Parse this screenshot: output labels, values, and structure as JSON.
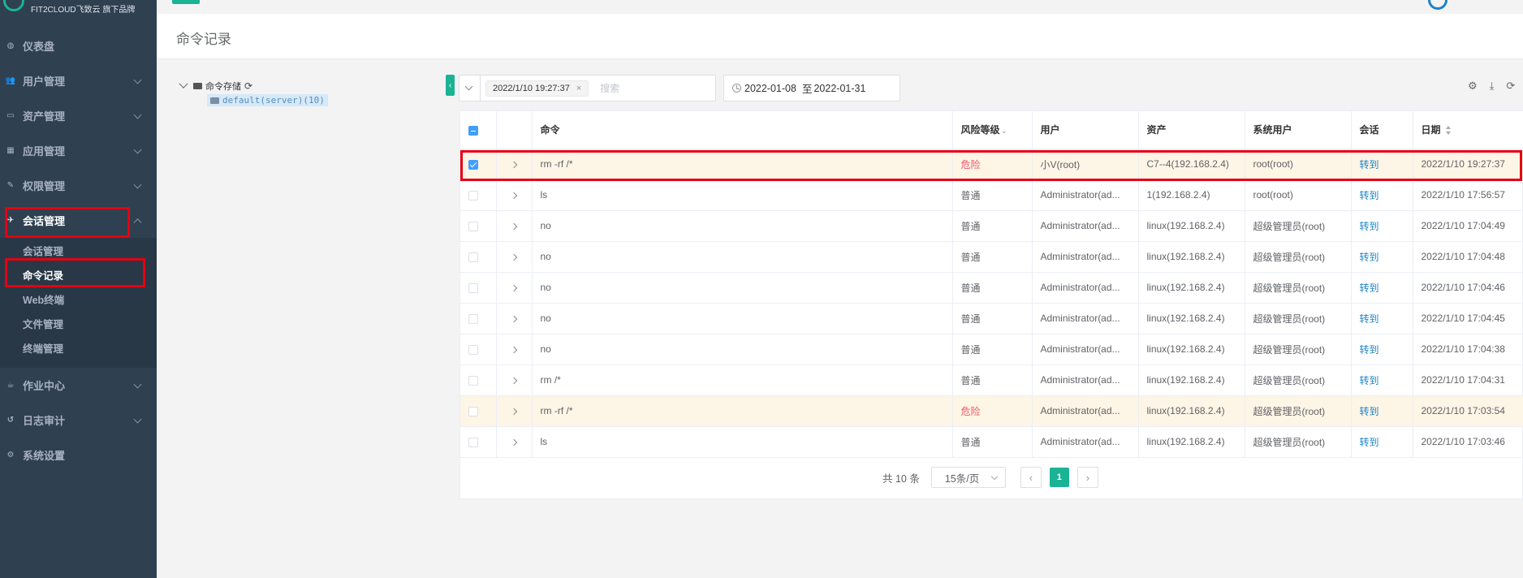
{
  "brand": {
    "text": "FIT2CLOUD飞致云 旗下品牌"
  },
  "sidebar": {
    "items": [
      {
        "label": "仪表盘",
        "icon": "dashboard-icon",
        "has_children": false
      },
      {
        "label": "用户管理",
        "icon": "users-icon",
        "has_children": true
      },
      {
        "label": "资产管理",
        "icon": "inbox-icon",
        "has_children": true
      },
      {
        "label": "应用管理",
        "icon": "grid-icon",
        "has_children": true
      },
      {
        "label": "权限管理",
        "icon": "edit-icon",
        "has_children": true
      },
      {
        "label": "会话管理",
        "icon": "rocket-icon",
        "has_children": true,
        "expanded": true
      }
    ],
    "submenu": [
      {
        "label": "会话管理"
      },
      {
        "label": "命令记录",
        "current": true
      },
      {
        "label": "Web终端"
      },
      {
        "label": "文件管理"
      },
      {
        "label": "终端管理"
      }
    ],
    "items_after": [
      {
        "label": "作业中心",
        "icon": "coffee-icon",
        "has_children": true
      },
      {
        "label": "日志审计",
        "icon": "history-icon",
        "has_children": true
      },
      {
        "label": "系统设置",
        "icon": "gears-icon",
        "has_children": false
      }
    ]
  },
  "page": {
    "title": "命令记录"
  },
  "tree": {
    "root_label": "命令存储",
    "child_label": "default(server)(10)"
  },
  "search": {
    "tag": "2022/1/10 19:27:37",
    "tag_close": "×",
    "placeholder": "搜索"
  },
  "date_range": {
    "start": "2022-01-08",
    "separator": "至",
    "end": "2022-01-31"
  },
  "table": {
    "headers": {
      "command": "命令",
      "risk": "风险等级",
      "user": "用户",
      "asset": "资产",
      "system_user": "系统用户",
      "session": "会话",
      "date": "日期"
    },
    "rows": [
      {
        "command": "rm -rf /*",
        "risk": "危险",
        "user": "小V(root)",
        "asset": "C7--4(192.168.2.4)",
        "system_user": "root(root)",
        "session": "转到",
        "date": "2022/1/10 19:27:37"
      },
      {
        "command": "ls",
        "risk": "普通",
        "user": "Administrator(ad...",
        "asset": "1(192.168.2.4)",
        "system_user": "root(root)",
        "session": "转到",
        "date": "2022/1/10 17:56:57"
      },
      {
        "command": "no",
        "risk": "普通",
        "user": "Administrator(ad...",
        "asset": "linux(192.168.2.4)",
        "system_user": "超级管理员(root)",
        "session": "转到",
        "date": "2022/1/10 17:04:49"
      },
      {
        "command": "no",
        "risk": "普通",
        "user": "Administrator(ad...",
        "asset": "linux(192.168.2.4)",
        "system_user": "超级管理员(root)",
        "session": "转到",
        "date": "2022/1/10 17:04:48"
      },
      {
        "command": "no",
        "risk": "普通",
        "user": "Administrator(ad...",
        "asset": "linux(192.168.2.4)",
        "system_user": "超级管理员(root)",
        "session": "转到",
        "date": "2022/1/10 17:04:46"
      },
      {
        "command": "no",
        "risk": "普通",
        "user": "Administrator(ad...",
        "asset": "linux(192.168.2.4)",
        "system_user": "超级管理员(root)",
        "session": "转到",
        "date": "2022/1/10 17:04:45"
      },
      {
        "command": "no",
        "risk": "普通",
        "user": "Administrator(ad...",
        "asset": "linux(192.168.2.4)",
        "system_user": "超级管理员(root)",
        "session": "转到",
        "date": "2022/1/10 17:04:38"
      },
      {
        "command": "rm /*",
        "risk": "普通",
        "user": "Administrator(ad...",
        "asset": "linux(192.168.2.4)",
        "system_user": "超级管理员(root)",
        "session": "转到",
        "date": "2022/1/10 17:04:31"
      },
      {
        "command": "rm -rf /*",
        "risk": "危险",
        "user": "Administrator(ad...",
        "asset": "linux(192.168.2.4)",
        "system_user": "超级管理员(root)",
        "session": "转到",
        "date": "2022/1/10 17:03:54"
      },
      {
        "command": "ls",
        "risk": "普通",
        "user": "Administrator(ad...",
        "asset": "linux(192.168.2.4)",
        "system_user": "超级管理员(root)",
        "session": "转到",
        "date": "2022/1/10 17:03:46"
      }
    ]
  },
  "pagination": {
    "total": "共 10 条",
    "page_size": "15条/页",
    "current_page": "1",
    "prev": "‹",
    "next": "›"
  },
  "colors": {
    "sidebar_bg": "#2f4050",
    "accent": "#1ab394",
    "danger": "#ed5565",
    "link": "#1c84c6",
    "highlight": "#e60012"
  }
}
